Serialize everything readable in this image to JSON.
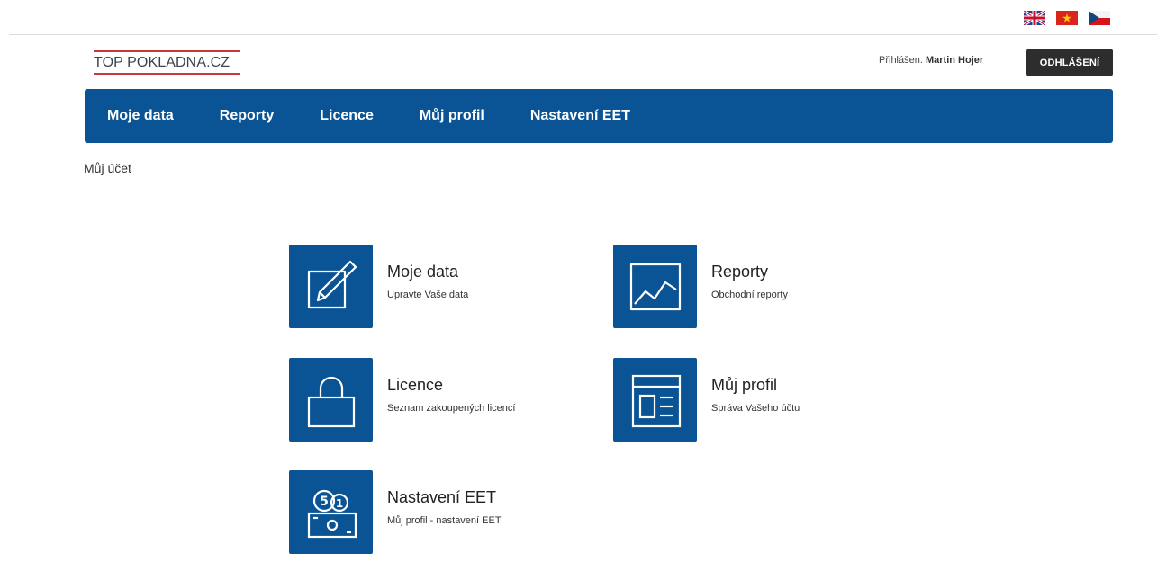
{
  "languages": [
    {
      "name": "english-flag-icon"
    },
    {
      "name": "vietnamese-flag-icon"
    },
    {
      "name": "czech-flag-icon"
    }
  ],
  "logo": {
    "text": "TOP POKLADNA.CZ"
  },
  "header": {
    "login_label": "Přihlášen:",
    "user_name": "Martin Hojer",
    "logout_label": "ODHLÁŠENÍ"
  },
  "nav": {
    "items": [
      {
        "label": "Moje data"
      },
      {
        "label": "Reporty"
      },
      {
        "label": "Licence"
      },
      {
        "label": "Můj profil"
      },
      {
        "label": "Nastavení EET"
      }
    ]
  },
  "breadcrumb": "Můj účet",
  "tiles": [
    {
      "title": "Moje data",
      "subtitle": "Upravte Vaše data",
      "icon": "edit-icon"
    },
    {
      "title": "Reporty",
      "subtitle": "Obchodní reporty",
      "icon": "chart-icon"
    },
    {
      "title": "Licence",
      "subtitle": "Seznam zakoupených licencí",
      "icon": "lock-icon"
    },
    {
      "title": "Můj profil",
      "subtitle": "Správa Vašeho účtu",
      "icon": "profile-page-icon"
    },
    {
      "title": "Nastavení EET",
      "subtitle": "Můj profil - nastavení EET",
      "icon": "money-icon"
    }
  ],
  "colors": {
    "primary": "#0a5394",
    "logout_bg": "#2d2d2d",
    "logo_accent": "#c8383a"
  }
}
